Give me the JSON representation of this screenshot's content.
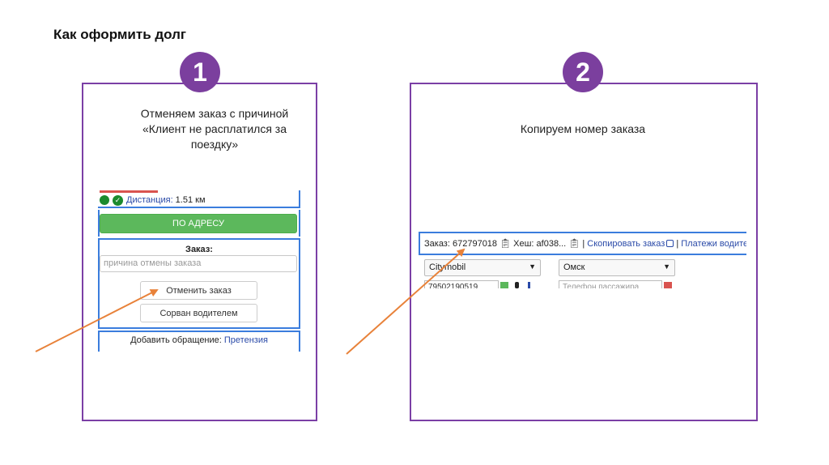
{
  "page": {
    "title": "Как оформить долг"
  },
  "colors": {
    "purple": "#7b3f9e",
    "green": "#5cb85c",
    "blue": "#3b7ddd",
    "arrow": "#e8823a",
    "link": "#2a4aa8"
  },
  "step1": {
    "number": "1",
    "instruction_line1": "Отменяем заказ с причиной",
    "instruction_line2": "«Клиент не расплатился за",
    "instruction_line3": "поездку»",
    "screenshot": {
      "distance_label": "Дистанция:",
      "distance_value": "1.51 км",
      "address_button": "ПО АДРЕСУ",
      "order_label": "Заказ:",
      "reason_placeholder": "причина отмены заказа",
      "cancel_button": "Отменить заказ",
      "driver_button": "Сорван водителем",
      "appeal_label": "Добавить обращение:",
      "appeal_link": "Претензия"
    }
  },
  "step2": {
    "number": "2",
    "instruction": "Копируем номер заказа",
    "screenshot": {
      "order_prefix": "Заказ:",
      "order_number": "672797018",
      "hash_prefix": "Хеш:",
      "hash_value": "af038...",
      "separator": "|",
      "copy_order_link": "Скопировать заказ",
      "driver_payments_link": "Платежи водителя",
      "company_select": "Citymobil",
      "city_select": "Омск",
      "phone_value": "79502190519",
      "passenger_phone_placeholder": "Телефон пассажира"
    }
  }
}
